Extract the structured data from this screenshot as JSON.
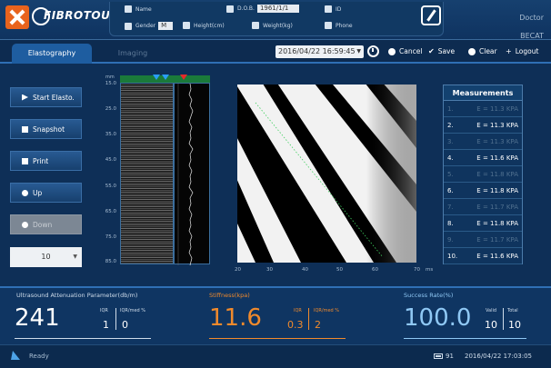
{
  "header": {
    "brand": "FIBROTOUCH",
    "doctor_label": "Doctor",
    "doctor_name": "BECAT",
    "patient": {
      "name_label": "Name",
      "name_value": "",
      "dob_label": "D.O.B.",
      "dob_value": "1961/1/1",
      "id_label": "ID",
      "id_value": "",
      "gender_label": "Gender",
      "gender_value": "M",
      "height_label": "Height(cm)",
      "height_value": "",
      "weight_label": "Weight(kg)",
      "weight_value": "",
      "phone_label": "Phone",
      "phone_value": ""
    }
  },
  "tabs": [
    {
      "label": "Elastography",
      "active": true
    },
    {
      "label": "Imaging",
      "active": false
    }
  ],
  "toolbar": {
    "datetime": "2016/04/22 16:59:45",
    "cancel_label": "Cancel",
    "save_label": "Save",
    "clear_label": "Clear",
    "logout_label": "Logout"
  },
  "left_buttons": {
    "start_label": "Start Elasto.",
    "snapshot_label": "Snapshot",
    "print_label": "Print",
    "up_label": "Up",
    "down_label": "Down",
    "depth_value": "10"
  },
  "depth_axis": {
    "unit": "mm",
    "ticks": [
      "15.0",
      "25.0",
      "35.0",
      "45.0",
      "55.0",
      "65.0",
      "75.0",
      "85.0"
    ]
  },
  "time_axis": {
    "unit": "ms",
    "ticks": [
      "20",
      "30",
      "40",
      "50",
      "60",
      "70"
    ]
  },
  "measurements": {
    "title": "Measurements",
    "rows": [
      {
        "index": "1.",
        "value": "E = 11.3  KPA",
        "valid": false
      },
      {
        "index": "2.",
        "value": "E = 11.3  KPA",
        "valid": true
      },
      {
        "index": "3.",
        "value": "E = 11.3  KPA",
        "valid": false
      },
      {
        "index": "4.",
        "value": "E = 11.6  KPA",
        "valid": true
      },
      {
        "index": "5.",
        "value": "E = 11.8  KPA",
        "valid": false
      },
      {
        "index": "6.",
        "value": "E = 11.8  KPA",
        "valid": true
      },
      {
        "index": "7.",
        "value": "E = 11.7  KPA",
        "valid": false
      },
      {
        "index": "8.",
        "value": "E = 11.8  KPA",
        "valid": true
      },
      {
        "index": "9.",
        "value": "E = 11.7  KPA",
        "valid": false
      },
      {
        "index": "10.",
        "value": "E = 11.6  KPA",
        "valid": true
      }
    ]
  },
  "results": {
    "uap": {
      "title": "Ultrasound Attenuation Parameter(db/m)",
      "value": "241",
      "iqr_label": "IQR",
      "iqr_value": "1",
      "iqrmed_label": "IQR/med %",
      "iqrmed_value": "0"
    },
    "stiffness": {
      "title": "Stiffness(kpa)",
      "value": "11.6",
      "iqr_label": "IQR",
      "iqr_value": "0.3",
      "iqrmed_label": "IQR/med %",
      "iqrmed_value": "2"
    },
    "success": {
      "title": "Success Rate(%)",
      "value": "100.0",
      "valid_label": "Valid",
      "valid_value": "10",
      "total_label": "Total",
      "total_value": "10"
    }
  },
  "colors": {
    "accent": "#e8631d",
    "stiffness": "#f08a2c",
    "success": "#8fc8f4",
    "primary": "#1e5da0"
  },
  "status": {
    "text": "Ready",
    "battery": "91",
    "time": "2016/04/22 17:03:05"
  }
}
